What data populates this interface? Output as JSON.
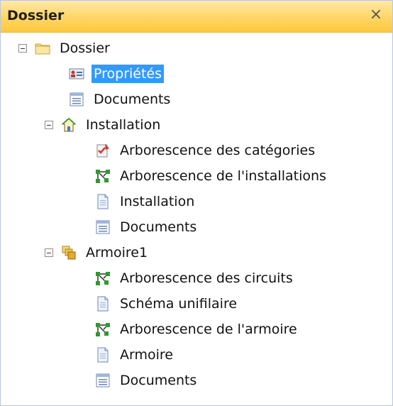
{
  "panel": {
    "title": "Dossier",
    "close_glyph": "×"
  },
  "tree": {
    "root": {
      "label": "Dossier",
      "icon": "folder-icon",
      "children": [
        {
          "label": "Propriétés",
          "icon": "properties-icon",
          "selected": true
        },
        {
          "label": "Documents",
          "icon": "documents-icon"
        }
      ]
    },
    "installation": {
      "label": "Installation",
      "icon": "home-icon",
      "children": [
        {
          "label": "Arborescence des catégories",
          "icon": "category-tree-icon"
        },
        {
          "label": "Arborescence de l'installations",
          "icon": "network-tree-icon"
        },
        {
          "label": "Installation",
          "icon": "page-icon"
        },
        {
          "label": "Documents",
          "icon": "documents-icon"
        }
      ]
    },
    "armoire": {
      "label": "Armoire1",
      "icon": "cabinet-icon",
      "children": [
        {
          "label": "Arborescence des circuits",
          "icon": "network-tree-icon"
        },
        {
          "label": "Schéma unifilaire",
          "icon": "page-icon"
        },
        {
          "label": "Arborescence de l'armoire",
          "icon": "network-tree-icon"
        },
        {
          "label": "Armoire",
          "icon": "page-icon"
        },
        {
          "label": "Documents",
          "icon": "documents-icon"
        }
      ]
    }
  }
}
